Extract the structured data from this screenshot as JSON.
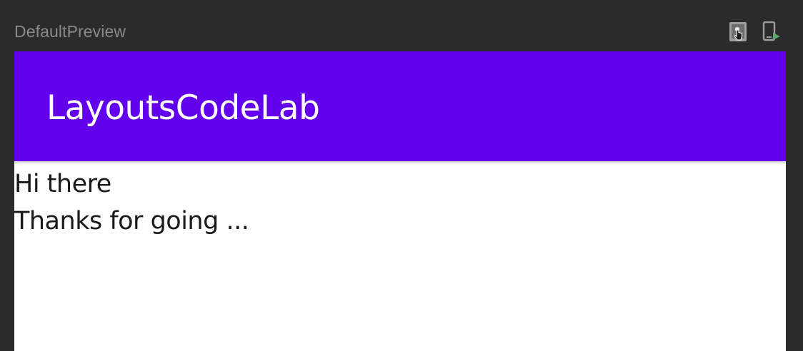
{
  "preview": {
    "title": "DefaultPreview",
    "toolbar": {
      "interactive_mode_icon": "interactive-mode-icon",
      "deploy_preview_icon": "deploy-to-device-icon"
    }
  },
  "app": {
    "title": "LayoutsCodeLab",
    "app_bar_color": "#6200ee",
    "body": {
      "line1": "Hi there",
      "line2": "Thanks for going ..."
    }
  },
  "colors": {
    "ide_background": "#2b2b2b",
    "run_accent": "#59a869"
  }
}
